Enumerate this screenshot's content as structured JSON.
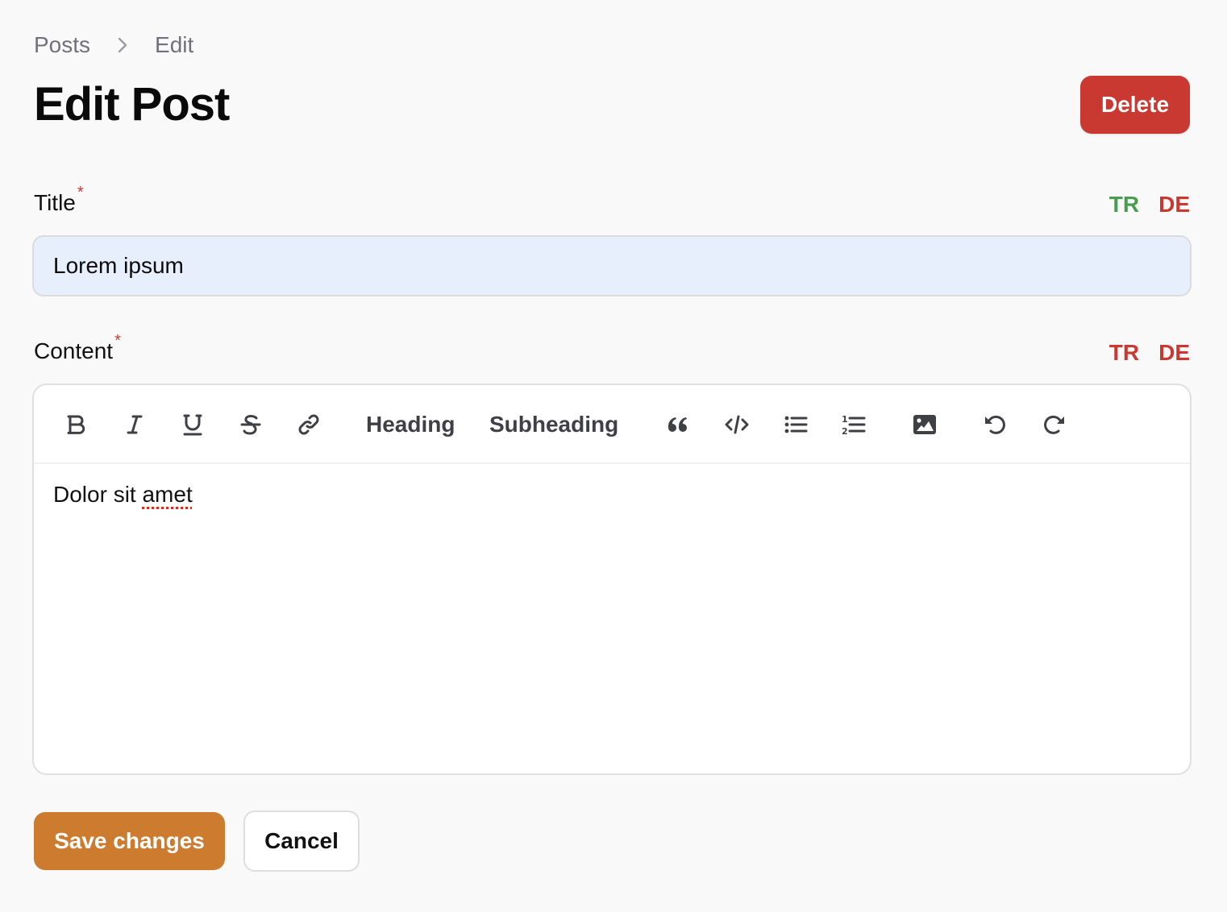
{
  "breadcrumb": {
    "items": [
      "Posts",
      "Edit"
    ],
    "separator_icon": "chevron-right-icon"
  },
  "page": {
    "title": "Edit Post",
    "delete_label": "Delete"
  },
  "colors": {
    "delete": "#c93931",
    "save": "#cd7b2f",
    "lang_translated": "#4a9d4f",
    "lang_missing": "#c93931",
    "required": "#d03a2e",
    "title_input_bg": "#e8effc"
  },
  "fields": {
    "title": {
      "label": "Title",
      "required_mark": "*",
      "value": "Lorem ipsum",
      "languages": [
        {
          "code": "TR",
          "status": "translated"
        },
        {
          "code": "DE",
          "status": "missing"
        }
      ]
    },
    "content": {
      "label": "Content",
      "required_mark": "*",
      "body_prefix": "Dolor sit ",
      "body_misspelled": "amet",
      "languages": [
        {
          "code": "TR",
          "status": "missing"
        },
        {
          "code": "DE",
          "status": "missing"
        }
      ]
    }
  },
  "toolbar": {
    "bold": "bold-icon",
    "italic": "italic-icon",
    "underline": "underline-icon",
    "strike": "strikethrough-icon",
    "link": "link-icon",
    "heading_label": "Heading",
    "subheading_label": "Subheading",
    "quote": "quote-icon",
    "code": "code-icon",
    "bullet_list": "bullet-list-icon",
    "ordered_list": "ordered-list-icon",
    "image": "image-icon",
    "undo": "undo-icon",
    "redo": "redo-icon"
  },
  "actions": {
    "save_label": "Save changes",
    "cancel_label": "Cancel"
  }
}
